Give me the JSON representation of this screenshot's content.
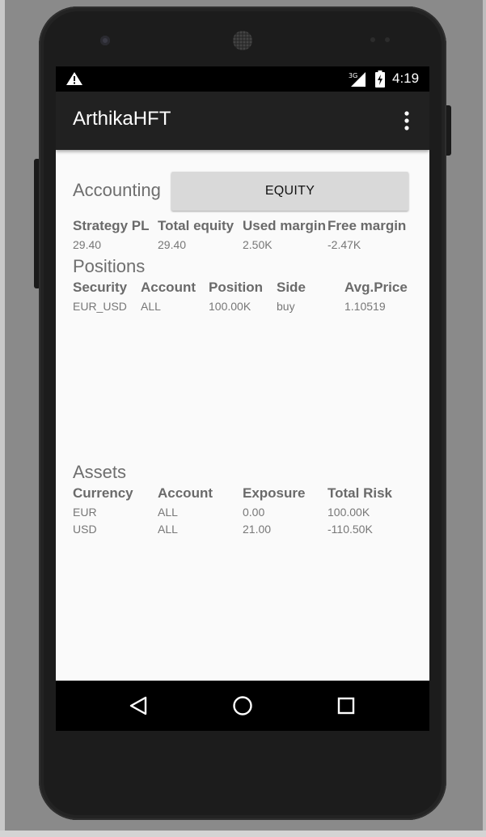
{
  "status_bar": {
    "time": "4:19",
    "network": "3G",
    "icons": [
      "warning-icon",
      "signal-icon",
      "battery-icon"
    ]
  },
  "app_bar": {
    "title": "ArthikaHFT",
    "menu_icon": "overflow-menu-icon"
  },
  "accounting": {
    "title": "Accounting",
    "button_label": "EQUITY",
    "headers": [
      "Strategy PL",
      "Total equity",
      "Used margin",
      "Free margin"
    ],
    "values": [
      "29.40",
      "29.40",
      "2.50K",
      "-2.47K"
    ]
  },
  "positions": {
    "title": "Positions",
    "headers": [
      "Security",
      "Account",
      "Position",
      "Side",
      "Avg.Price"
    ],
    "rows": [
      [
        "EUR_USD",
        "ALL",
        "100.00K",
        "buy",
        "1.10519"
      ]
    ]
  },
  "assets": {
    "title": "Assets",
    "headers": [
      "Currency",
      "Account",
      "Exposure",
      "Total Risk"
    ],
    "rows": [
      [
        "EUR",
        "ALL",
        "0.00",
        "100.00K"
      ],
      [
        "USD",
        "ALL",
        "21.00",
        "-110.50K"
      ]
    ]
  },
  "nav_bar": {
    "icons": [
      "back-icon",
      "home-icon",
      "recents-icon"
    ]
  }
}
